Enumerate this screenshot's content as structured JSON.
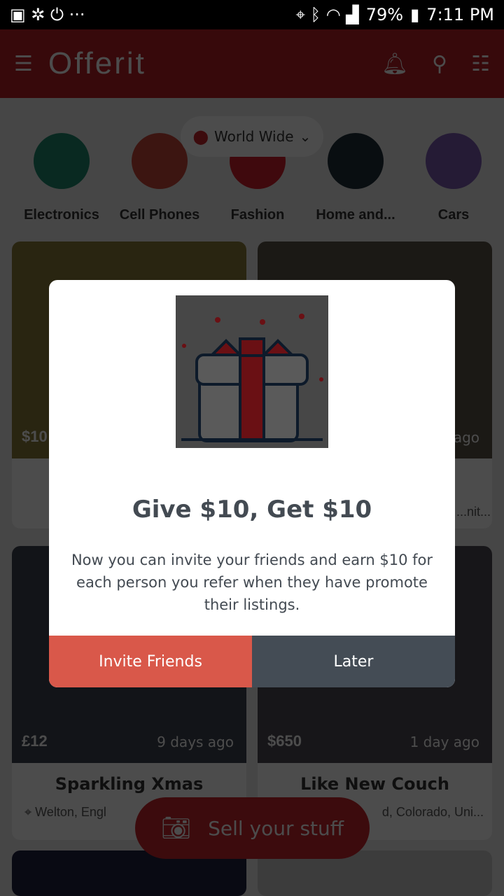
{
  "status_bar": {
    "battery": "79%",
    "time": "7:11 PM"
  },
  "header": {
    "logo": "Offerit",
    "icons": [
      "menu-icon",
      "bell-icon",
      "search-icon",
      "filter-icon"
    ]
  },
  "location": {
    "label": "World Wide"
  },
  "categories": [
    {
      "label": "Electronics",
      "color": "#1f8a6e"
    },
    {
      "label": "Cell Phones",
      "color": "#c8463a"
    },
    {
      "label": "Fashion",
      "color": "#d21f2a"
    },
    {
      "label": "Home and...",
      "color": "#1f2d3a"
    },
    {
      "label": "Cars",
      "color": "#7a5ab0"
    }
  ],
  "listings": [
    {
      "price": "$10",
      "ago": "",
      "title": "",
      "place": ""
    },
    {
      "price": "",
      "ago": "ago",
      "title": "",
      "place": "...nit..."
    },
    {
      "price": "£12",
      "ago": "9 days ago",
      "title": "Sparkling Xmas",
      "place": "Welton, Engl"
    },
    {
      "price": "$650",
      "ago": "1 day ago",
      "title": "Like New Couch",
      "place": "d, Colorado, Uni..."
    }
  ],
  "fab": {
    "label": "Sell your stuff"
  },
  "modal": {
    "title": "Give $10, Get $10",
    "body": "Now you can invite your friends and earn $10 for each person you refer when they have promote their listings.",
    "invite_label": "Invite Friends",
    "later_label": "Later",
    "invite_color": "#d9584a",
    "later_color": "#444c55"
  }
}
